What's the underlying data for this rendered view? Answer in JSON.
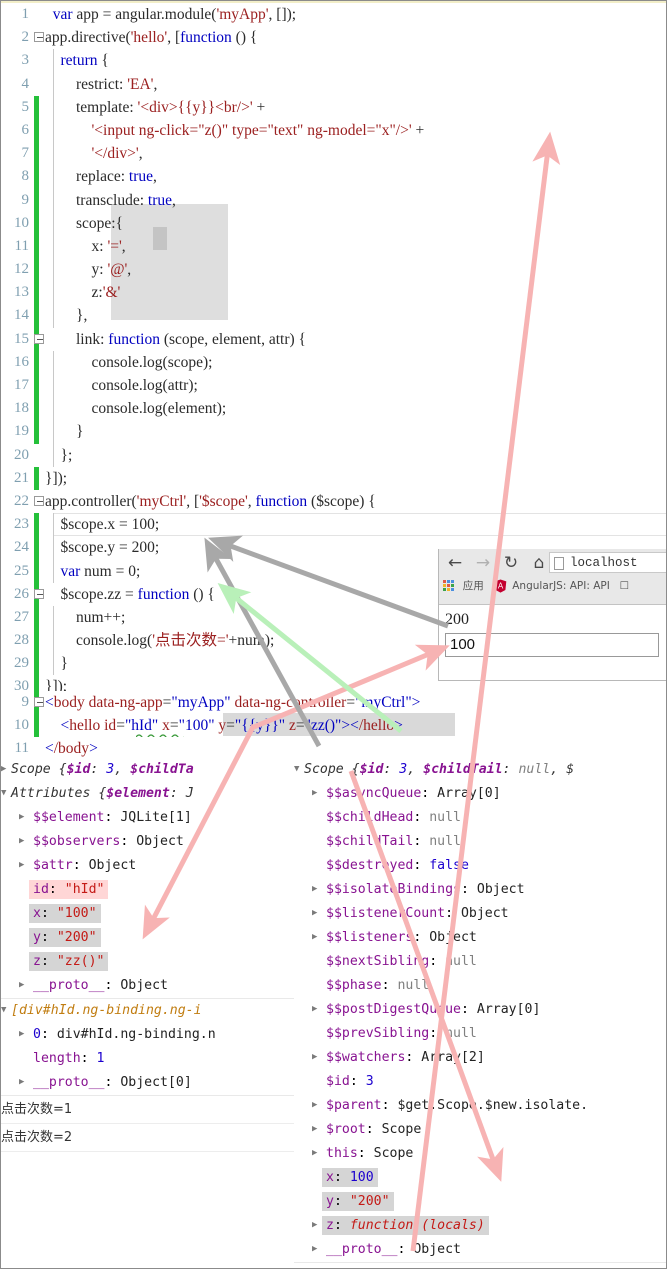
{
  "editor": {
    "lines": [
      {
        "n": "1",
        "change": false,
        "fold": false,
        "vline": false,
        "text": "  var app = angular.module('myApp', []);"
      },
      {
        "n": "2",
        "change": false,
        "fold": true,
        "vline": false,
        "text": "app.directive('hello', [function () {"
      },
      {
        "n": "3",
        "change": false,
        "fold": false,
        "vline": true,
        "text": "    return {"
      },
      {
        "n": "4",
        "change": false,
        "fold": false,
        "vline": true,
        "text": "        restrict: 'EA',"
      },
      {
        "n": "5",
        "change": true,
        "fold": false,
        "vline": true,
        "text": "        template: '<div>{{y}}<br/>' +"
      },
      {
        "n": "6",
        "change": true,
        "fold": false,
        "vline": true,
        "text": "            '<input ng-click=\"z()\" type=\"text\" ng-model=\"x\"/>' +"
      },
      {
        "n": "7",
        "change": true,
        "fold": false,
        "vline": true,
        "text": "            '</div>',"
      },
      {
        "n": "8",
        "change": true,
        "fold": false,
        "vline": true,
        "text": "        replace: true,"
      },
      {
        "n": "9",
        "change": true,
        "fold": false,
        "vline": true,
        "text": "        transclude: true,"
      },
      {
        "n": "10",
        "change": true,
        "fold": false,
        "vline": true,
        "text": "        scope:{"
      },
      {
        "n": "11",
        "change": true,
        "fold": false,
        "vline": true,
        "text": "            x: '=',"
      },
      {
        "n": "12",
        "change": true,
        "fold": false,
        "vline": true,
        "text": "            y: '@',"
      },
      {
        "n": "13",
        "change": true,
        "fold": false,
        "vline": true,
        "text": "            z:'&'"
      },
      {
        "n": "14",
        "change": true,
        "fold": false,
        "vline": true,
        "text": "        },"
      },
      {
        "n": "15",
        "change": true,
        "fold": true,
        "vline": true,
        "text": "        link: function (scope, element, attr) {"
      },
      {
        "n": "16",
        "change": true,
        "fold": false,
        "vline": true,
        "text": "            console.log(scope);"
      },
      {
        "n": "17",
        "change": true,
        "fold": false,
        "vline": true,
        "text": "            console.log(attr);"
      },
      {
        "n": "18",
        "change": true,
        "fold": false,
        "vline": true,
        "text": "            console.log(element);"
      },
      {
        "n": "19",
        "change": true,
        "fold": false,
        "vline": true,
        "text": "        }"
      },
      {
        "n": "20",
        "change": false,
        "fold": false,
        "vline": true,
        "text": "    };"
      },
      {
        "n": "21",
        "change": true,
        "fold": false,
        "vline": false,
        "text": "}]);"
      },
      {
        "n": "22",
        "change": false,
        "fold": true,
        "vline": false,
        "text": "app.controller('myCtrl', ['$scope', function ($scope) {"
      },
      {
        "n": "23",
        "change": true,
        "fold": false,
        "vline": true,
        "text": "    $scope.x = 100;"
      },
      {
        "n": "24",
        "change": true,
        "fold": false,
        "vline": true,
        "text": "    $scope.y = 200;"
      },
      {
        "n": "25",
        "change": true,
        "fold": false,
        "vline": true,
        "text": "    var num = 0;"
      },
      {
        "n": "26",
        "change": true,
        "fold": true,
        "vline": true,
        "text": "    $scope.zz = function () {"
      },
      {
        "n": "27",
        "change": true,
        "fold": false,
        "vline": true,
        "text": "        num++;"
      },
      {
        "n": "28",
        "change": true,
        "fold": false,
        "vline": true,
        "text": "        console.log('点击次数='+num);"
      },
      {
        "n": "29",
        "change": true,
        "fold": false,
        "vline": true,
        "text": "    }"
      },
      {
        "n": "30",
        "change": true,
        "fold": false,
        "vline": false,
        "text": "}]);"
      }
    ]
  },
  "html_pane": {
    "lines": [
      {
        "n": "9",
        "change": true,
        "fold": true,
        "text": "<body data-ng-app=\"myApp\" data-ng-controller=\"myCtrl\">"
      },
      {
        "n": "10",
        "change": true,
        "fold": false,
        "text": "    <hello id=\"hId\" x=\"100\" y=\"{{y}}\" z=\"zz()\"></hello>"
      },
      {
        "n": "11",
        "change": false,
        "fold": false,
        "text": "</body>"
      }
    ]
  },
  "browser": {
    "nav": {
      "back_icon": "back-arrow-icon",
      "forward_icon": "forward-arrow-icon",
      "reload_icon": "reload-icon",
      "home_icon": "home-icon",
      "url": "localhost"
    },
    "bookmarks": {
      "apps_icon": "apps-grid-icon",
      "apps_label": "应用",
      "angular_icon": "angularjs-shield-icon",
      "angular_label": "AngularJS: API: API"
    },
    "page": {
      "output_text": "200",
      "input_value": "100",
      "input_placeholder": ""
    }
  },
  "console_left": {
    "rows": [
      {
        "indent": 0,
        "tri": "right",
        "kind": "header-scope",
        "text": "Scope {$id: 3, $$childTa"
      },
      {
        "indent": 0,
        "tri": "down",
        "kind": "header-attrs",
        "text": "Attributes {$$element: J"
      },
      {
        "indent": 1,
        "tri": "right",
        "prop": "$$element",
        "sep": ": ",
        "value": "JQLite[1]",
        "vclass": "val-obj"
      },
      {
        "indent": 1,
        "tri": "right",
        "prop": "$$observers",
        "sep": ": ",
        "value": "Object",
        "vclass": "val-obj"
      },
      {
        "indent": 1,
        "tri": "right",
        "prop": "$attr",
        "sep": ": ",
        "value": "Object",
        "vclass": "val-obj"
      },
      {
        "indent": 1,
        "tri": "none",
        "prop": "id",
        "sep": ": ",
        "value": "\"hId\"",
        "vclass": "val-str",
        "hl": "pink"
      },
      {
        "indent": 1,
        "tri": "none",
        "prop": "x",
        "sep": ": ",
        "value": "\"100\"",
        "vclass": "val-str",
        "hl": "gray"
      },
      {
        "indent": 1,
        "tri": "none",
        "prop": "y",
        "sep": ": ",
        "value": "\"200\"",
        "vclass": "val-str",
        "hl": "gray"
      },
      {
        "indent": 1,
        "tri": "none",
        "prop": "z",
        "sep": ": ",
        "value": "\"zz()\"",
        "vclass": "val-str",
        "hl": "gray"
      },
      {
        "indent": 1,
        "tri": "right",
        "prop": "__proto__",
        "sep": ": ",
        "value": "Object",
        "vclass": "val-obj",
        "underline": true
      },
      {
        "indent": 0,
        "tri": "down",
        "kind": "header-array",
        "text": "[div#hId.ng-binding.ng-i"
      },
      {
        "indent": 1,
        "tri": "right",
        "prop": "0",
        "sep": ": ",
        "value": "div#hId.ng-binding.n",
        "vclass": "val-obj",
        "propclass": "val-num"
      },
      {
        "indent": 1,
        "tri": "none",
        "prop": "length",
        "sep": ": ",
        "value": "1",
        "vclass": "val-num"
      },
      {
        "indent": 1,
        "tri": "right",
        "prop": "__proto__",
        "sep": ": ",
        "value": "Object[0]",
        "vclass": "val-obj",
        "underline": true
      }
    ],
    "logs": [
      "点击次数=1",
      "点击次数=2"
    ]
  },
  "console_right": {
    "rows": [
      {
        "indent": 0,
        "tri": "down",
        "kind": "header-scope",
        "text": "Scope {$id: 3, $$childTail: null, $"
      },
      {
        "indent": 1,
        "tri": "right",
        "prop": "$$asyncQueue",
        "sep": ": ",
        "value": "Array[0]",
        "vclass": "val-obj"
      },
      {
        "indent": 1,
        "tri": "none",
        "prop": "$$childHead",
        "sep": ": ",
        "value": "null",
        "vclass": "val-null"
      },
      {
        "indent": 1,
        "tri": "none",
        "prop": "$$childTail",
        "sep": ": ",
        "value": "null",
        "vclass": "val-null"
      },
      {
        "indent": 1,
        "tri": "none",
        "prop": "$$destroyed",
        "sep": ": ",
        "value": "false",
        "vclass": "val-num"
      },
      {
        "indent": 1,
        "tri": "right",
        "prop": "$$isolateBindings",
        "sep": ": ",
        "value": "Object",
        "vclass": "val-obj"
      },
      {
        "indent": 1,
        "tri": "right",
        "prop": "$$listenerCount",
        "sep": ": ",
        "value": "Object",
        "vclass": "val-obj"
      },
      {
        "indent": 1,
        "tri": "right",
        "prop": "$$listeners",
        "sep": ": ",
        "value": "Object",
        "vclass": "val-obj"
      },
      {
        "indent": 1,
        "tri": "none",
        "prop": "$$nextSibling",
        "sep": ": ",
        "value": "null",
        "vclass": "val-null"
      },
      {
        "indent": 1,
        "tri": "none",
        "prop": "$$phase",
        "sep": ": ",
        "value": "null",
        "vclass": "val-null"
      },
      {
        "indent": 1,
        "tri": "right",
        "prop": "$$postDigestQueue",
        "sep": ": ",
        "value": "Array[0]",
        "vclass": "val-obj"
      },
      {
        "indent": 1,
        "tri": "none",
        "prop": "$$prevSibling",
        "sep": ": ",
        "value": "null",
        "vclass": "val-null"
      },
      {
        "indent": 1,
        "tri": "right",
        "prop": "$$watchers",
        "sep": ": ",
        "value": "Array[2]",
        "vclass": "val-obj"
      },
      {
        "indent": 1,
        "tri": "none",
        "prop": "$id",
        "sep": ": ",
        "value": "3",
        "vclass": "val-num"
      },
      {
        "indent": 1,
        "tri": "right",
        "prop": "$parent",
        "sep": ": ",
        "value": "$get.Scope.$new.isolate.",
        "vclass": "val-obj"
      },
      {
        "indent": 1,
        "tri": "right",
        "prop": "$root",
        "sep": ": ",
        "value": "Scope",
        "vclass": "val-obj"
      },
      {
        "indent": 1,
        "tri": "right",
        "prop": "this",
        "sep": ": ",
        "value": "Scope",
        "vclass": "val-obj"
      },
      {
        "indent": 1,
        "tri": "none",
        "prop": "x",
        "sep": ": ",
        "value": "100",
        "vclass": "val-num",
        "hl": "gray"
      },
      {
        "indent": 1,
        "tri": "none",
        "prop": "y",
        "sep": ": ",
        "value": "\"200\"",
        "vclass": "val-str",
        "hl": "gray"
      },
      {
        "indent": 1,
        "tri": "right",
        "prop": "z",
        "sep": ": ",
        "value": "function (locals)",
        "vclass": "val-fn",
        "hl": "gray"
      },
      {
        "indent": 1,
        "tri": "right",
        "prop": "__proto__",
        "sep": ": ",
        "value": "Object",
        "vclass": "val-obj",
        "underline": true
      }
    ]
  },
  "annotations": {
    "arrow_color_pink": "#f7b3b3",
    "arrow_color_gray": "#a8a8a8",
    "arrow_color_green": "#b9f0b9",
    "arrows": [
      {
        "name": "arrow-scope-x-to-ngmodel",
        "color": "#f7b3b3"
      },
      {
        "name": "arrow-attrs-x-to-hello-x",
        "color": "#f7b3b3"
      },
      {
        "name": "arrow-hello-x-to-input",
        "color": "#f7b3b3"
      },
      {
        "name": "arrow-scope-y-to-codey",
        "color": "#a8a8a8"
      },
      {
        "name": "arrow-hello-y-to-codey",
        "color": "#a8a8a8"
      },
      {
        "name": "arrow-zz-to-hello-z",
        "color": "#b9f0b9"
      }
    ]
  }
}
